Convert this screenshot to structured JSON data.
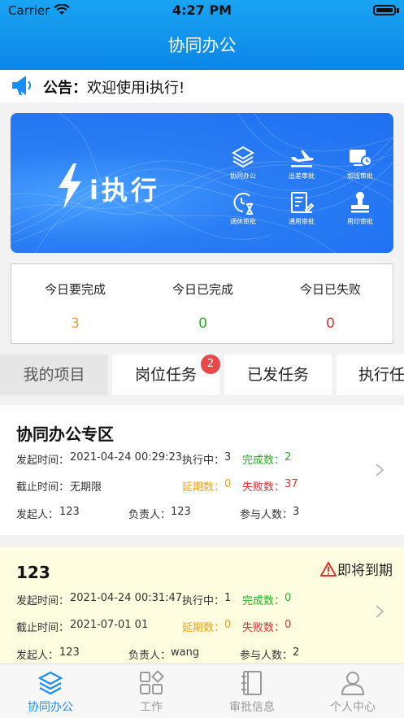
{
  "status_bar": {
    "carrier": "Carrier",
    "time": "4:27 PM"
  },
  "header": {
    "title": "协同办公"
  },
  "notice": {
    "label": "公告：",
    "text": "欢迎使用i执行!"
  },
  "banner": {
    "brand": "i执行",
    "apps": [
      {
        "label": "协同办公",
        "icon": "layers-icon"
      },
      {
        "label": "出差审批",
        "icon": "airplane-icon"
      },
      {
        "label": "加班审批",
        "icon": "overtime-clock-icon"
      },
      {
        "label": "调休审批",
        "icon": "hourglass-clock-icon"
      },
      {
        "label": "通用审批",
        "icon": "document-pen-icon"
      },
      {
        "label": "用印审批",
        "icon": "stamp-icon"
      }
    ]
  },
  "stats": [
    {
      "title": "今日要完成",
      "value": "3",
      "color": "#f3a21d"
    },
    {
      "title": "今日已完成",
      "value": "0",
      "color": "#22b522"
    },
    {
      "title": "今日已失败",
      "value": "0",
      "color": "#e2302f"
    }
  ],
  "tabs": [
    {
      "label": "我的项目",
      "active": true
    },
    {
      "label": "岗位任务",
      "badge": "2"
    },
    {
      "label": "已发任务"
    },
    {
      "label": "执行任"
    }
  ],
  "projects": [
    {
      "title": "协同办公专区",
      "start_label": "发起时间：",
      "start": "2021-04-24 00:29:23",
      "status_label": "执行中：",
      "status": "3",
      "done_label": "完成数：",
      "done": "2",
      "deadline_label": "截止时间：",
      "deadline": "无期限",
      "delay_label": "延期数：",
      "delay": "0",
      "fail_label": "失败数：",
      "fail": "37",
      "initiator_label": "发起人：",
      "initiator": "123",
      "owner_label": "负责人：",
      "owner": "123",
      "members_label": "参与人数：",
      "members": "3"
    },
    {
      "title": "123",
      "warning": "即将到期",
      "start_label": "发起时间：",
      "start": "2021-04-24 00:31:47",
      "status_label": "执行中：",
      "status": "1",
      "done_label": "完成数：",
      "done": "0",
      "deadline_label": "截止时间：",
      "deadline": "2021-07-01 01",
      "delay_label": "延期数：",
      "delay": "0",
      "fail_label": "失败数：",
      "fail": "0",
      "initiator_label": "发起人：",
      "initiator": "123",
      "owner_label": "负责人：",
      "owner": "wang",
      "members_label": "参与人数：",
      "members": "2"
    }
  ],
  "tabbar": [
    {
      "label": "协同办公",
      "icon": "layers-icon",
      "active": true
    },
    {
      "label": "工作",
      "icon": "grid-icon"
    },
    {
      "label": "审批信息",
      "icon": "notebook-icon"
    },
    {
      "label": "个人中心",
      "icon": "person-icon"
    }
  ],
  "colors": {
    "accent": "#1a8df0",
    "orange": "#f3a21d",
    "green": "#22b522",
    "red": "#e2302f",
    "warning_bg": "#fffde0"
  }
}
